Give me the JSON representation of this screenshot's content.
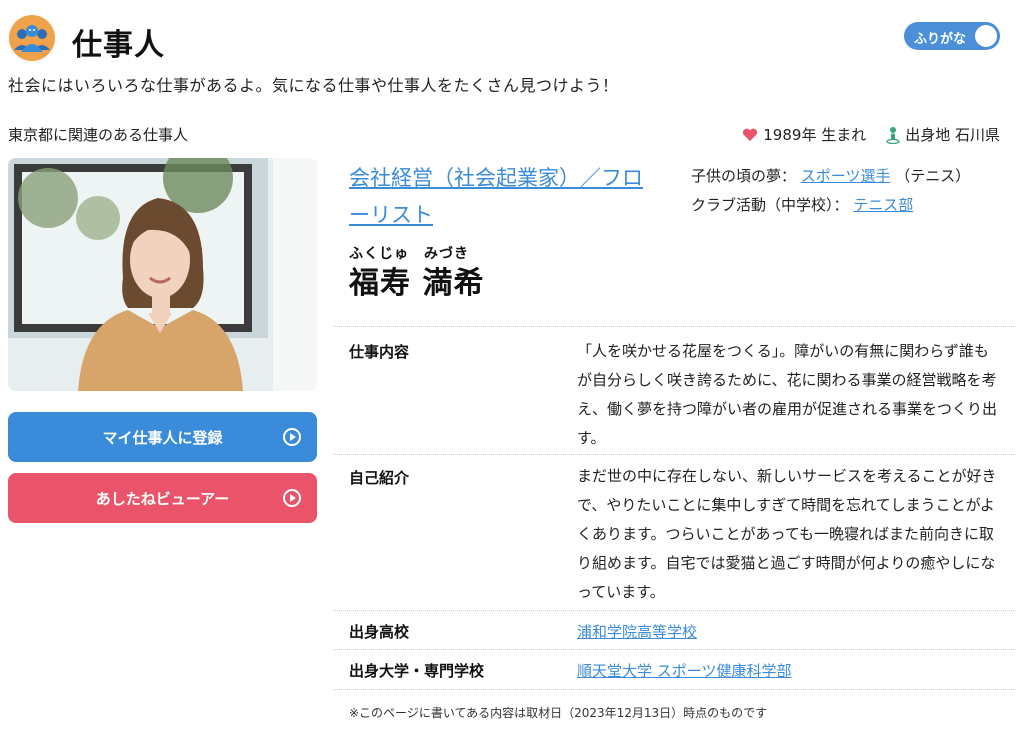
{
  "header": {
    "site_title": "仕事人",
    "furigana_toggle_label": "ふりがな",
    "logo_icon": "people-group-icon"
  },
  "tagline": "社会にはいろいろな仕事があるよ。気になる仕事や仕事人をたくさん見つけよう！",
  "section_title": "東京都に関連のある仕事人",
  "meta": {
    "birth": "1989年 生まれ",
    "birthplace": "出身地 石川県",
    "heart_icon": "heart-icon",
    "person_icon": "person-pin-icon"
  },
  "buttons": {
    "register": "マイ仕事人に登録",
    "viewer": "あしたねビューアー"
  },
  "profile": {
    "job_title": "会社経営（社会起業家）／フローリスト",
    "name_ruby": "ふくじゅ　みづき",
    "name": "福寿 満希",
    "dream_label": "子供の頃の夢：",
    "dream_link": "スポーツ選手",
    "dream_note": "（テニス）",
    "club_label": "クラブ活動（中学校）：",
    "club_link": "テニス部"
  },
  "details": {
    "work_label": "仕事内容",
    "work_text": "「人を咲かせる花屋をつくる」。障がいの有無に関わらず誰もが自分らしく咲き誇るために、花に関わる事業の経営戦略を考え、働く夢を持つ障がい者の雇用が促進される事業をつくり出す。",
    "intro_label": "自己紹介",
    "intro_text": "まだ世の中に存在しない、新しいサービスを考えることが好きで、やりたいことに集中しすぎて時間を忘れてしまうことがよくあります。つらいことがあっても一晩寝ればまた前向きに取り組めます。自宅では愛猫と過ごす時間が何よりの癒やしになっています。",
    "school_label": "出身高校",
    "school_link": "浦和学院高等学校",
    "univ_label": "出身大学・専門学校",
    "univ_link": "順天堂大学 スポーツ健康科学部"
  },
  "footnote": "※このページに書いてある内容は取材日（2023年12月13日）時点のものです",
  "colors": {
    "accent_blue": "#3a8bd9",
    "accent_pink": "#e9546b"
  }
}
